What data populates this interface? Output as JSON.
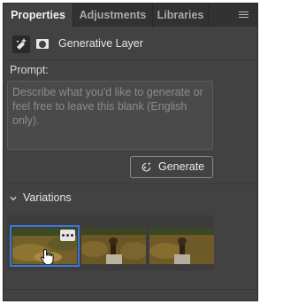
{
  "tabs": [
    {
      "label": "Properties",
      "active": true
    },
    {
      "label": "Adjustments",
      "active": false
    },
    {
      "label": "Libraries",
      "active": false
    }
  ],
  "layer": {
    "title": "Generative Layer",
    "icon": "generative-layer-icon",
    "mask_icon": "mask-icon"
  },
  "prompt": {
    "label": "Prompt:",
    "value": "",
    "placeholder": "Describe what you'd like to generate or feel free to leave this blank (English only)."
  },
  "generate_button": {
    "label": "Generate",
    "icon": "generate-sparkle-icon"
  },
  "variations": {
    "label": "Variations",
    "expanded": true,
    "items": [
      {
        "description": "thumbnail-1",
        "selected": true
      },
      {
        "description": "thumbnail-2",
        "selected": false
      },
      {
        "description": "thumbnail-3",
        "selected": false
      }
    ]
  },
  "colors": {
    "panel_bg": "#424242",
    "tabbar_bg": "#323232",
    "selection_accent": "#3a78d8"
  }
}
